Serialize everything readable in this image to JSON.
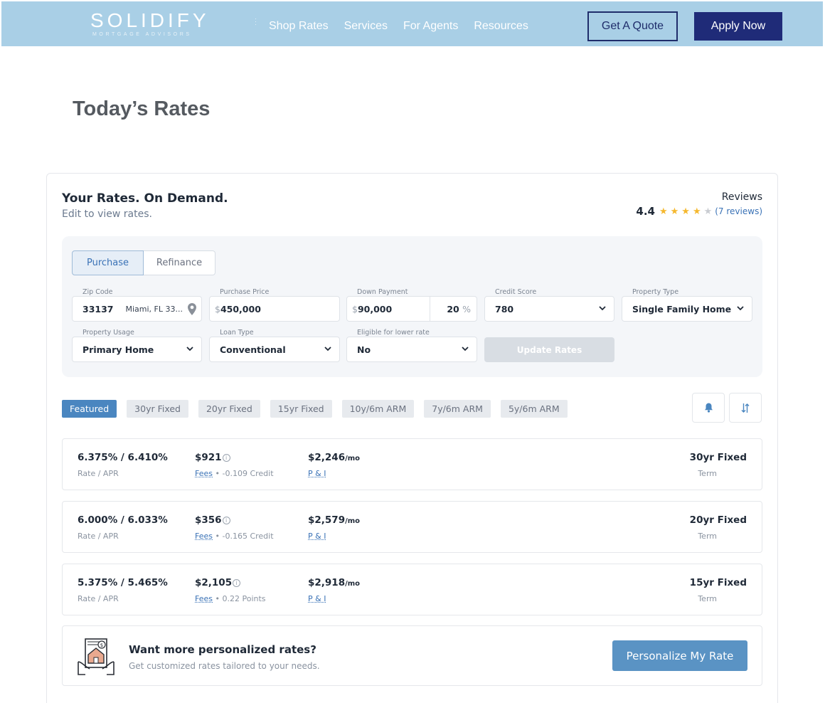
{
  "header": {
    "logo_text": "SOLIDIFY",
    "logo_subtext": "MORTGAGE ADVISORS",
    "nav": [
      "Shop Rates",
      "Services",
      "For Agents",
      "Resources"
    ],
    "get_quote_label": "Get A Quote",
    "apply_label": "Apply Now"
  },
  "page_title": "Today’s Rates",
  "card": {
    "title": "Your Rates. On Demand.",
    "subtitle": "Edit to view rates.",
    "reviews_label": "Reviews",
    "rating": "4.4",
    "reviews_link": "(7 reviews)"
  },
  "form": {
    "tabs": [
      "Purchase",
      "Refinance"
    ],
    "zip": {
      "label": "Zip Code",
      "value": "33137",
      "city": "Miami, FL 33..."
    },
    "price": {
      "label": "Purchase Price",
      "currency": "$",
      "value": "450,000"
    },
    "down": {
      "label": "Down Payment",
      "currency": "$",
      "value": "90,000",
      "percent": "20",
      "percent_sign": "%"
    },
    "credit": {
      "label": "Credit Score",
      "value": "780"
    },
    "property_type": {
      "label": "Property Type",
      "value": "Single Family Home"
    },
    "usage": {
      "label": "Property Usage",
      "value": "Primary Home"
    },
    "loan_type": {
      "label": "Loan Type",
      "value": "Conventional"
    },
    "eligible": {
      "label": "Eligible for lower rate",
      "value": "No"
    },
    "update_label": "Update Rates"
  },
  "chips": [
    "Featured",
    "30yr Fixed",
    "20yr Fixed",
    "15yr Fixed",
    "10y/6m ARM",
    "7y/6m ARM",
    "5y/6m ARM"
  ],
  "rates": [
    {
      "rate": "6.375% / 6.410%",
      "rate_label": "Rate / APR",
      "fee": "$921",
      "fees_label": "Fees",
      "fee_detail": " • -0.109 Credit",
      "payment": "$2,246",
      "per": "/mo",
      "pi_label": "P & I",
      "term": "30yr Fixed",
      "term_label": "Term"
    },
    {
      "rate": "6.000% / 6.033%",
      "rate_label": "Rate / APR",
      "fee": "$356",
      "fees_label": "Fees",
      "fee_detail": " • -0.165 Credit",
      "payment": "$2,579",
      "per": "/mo",
      "pi_label": "P & I",
      "term": "20yr Fixed",
      "term_label": "Term"
    },
    {
      "rate": "5.375% / 5.465%",
      "rate_label": "Rate / APR",
      "fee": "$2,105",
      "fees_label": "Fees",
      "fee_detail": " • 0.22 Points",
      "payment": "$2,918",
      "per": "/mo",
      "pi_label": "P & I",
      "term": "15yr Fixed",
      "term_label": "Term"
    }
  ],
  "personalize": {
    "title": "Want more personalized rates?",
    "subtitle": "Get customized rates tailored to your needs.",
    "button": "Personalize My Rate"
  }
}
